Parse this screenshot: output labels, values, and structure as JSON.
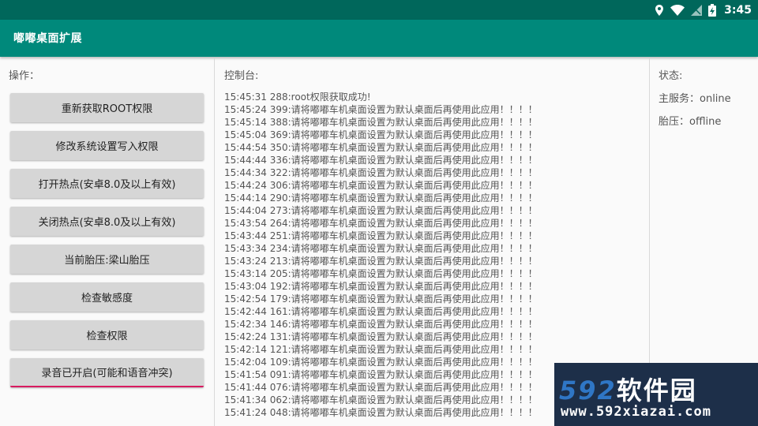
{
  "status_bar": {
    "time": "3:45",
    "icons": [
      "location-icon",
      "wifi-icon",
      "signal-icon",
      "battery-charging-icon"
    ]
  },
  "app_bar": {
    "title": "嘟嘟桌面扩展"
  },
  "operations": {
    "label": "操作：",
    "buttons": [
      "重新获取ROOT权限",
      "修改系统设置写入权限",
      "打开热点(安卓8.0及以上有效)",
      "关闭热点(安卓8.0及以上有效)",
      "当前胎压:梁山胎压",
      "检查敏感度",
      "检查权限",
      "录音已开启(可能和语音冲突)"
    ]
  },
  "console": {
    "label": "控制台:",
    "lines": [
      "15:45:31 288:root权限获取成功!",
      "15:45:24 399:请将嘟嘟车机桌面设置为默认桌面后再使用此应用！！！！",
      "15:45:14 388:请将嘟嘟车机桌面设置为默认桌面后再使用此应用！！！！",
      "15:45:04 369:请将嘟嘟车机桌面设置为默认桌面后再使用此应用！！！！",
      "15:44:54 350:请将嘟嘟车机桌面设置为默认桌面后再使用此应用！！！！",
      "15:44:44 336:请将嘟嘟车机桌面设置为默认桌面后再使用此应用！！！！",
      "15:44:34 322:请将嘟嘟车机桌面设置为默认桌面后再使用此应用！！！！",
      "15:44:24 306:请将嘟嘟车机桌面设置为默认桌面后再使用此应用！！！！",
      "15:44:14 290:请将嘟嘟车机桌面设置为默认桌面后再使用此应用！！！！",
      "15:44:04 273:请将嘟嘟车机桌面设置为默认桌面后再使用此应用！！！！",
      "15:43:54 264:请将嘟嘟车机桌面设置为默认桌面后再使用此应用！！！！",
      "15:43:44 251:请将嘟嘟车机桌面设置为默认桌面后再使用此应用！！！！",
      "15:43:34 234:请将嘟嘟车机桌面设置为默认桌面后再使用此应用！！！！",
      "15:43:24 213:请将嘟嘟车机桌面设置为默认桌面后再使用此应用！！！！",
      "15:43:14 205:请将嘟嘟车机桌面设置为默认桌面后再使用此应用！！！！",
      "15:43:04 192:请将嘟嘟车机桌面设置为默认桌面后再使用此应用！！！！",
      "15:42:54 179:请将嘟嘟车机桌面设置为默认桌面后再使用此应用！！！！",
      "15:42:44 161:请将嘟嘟车机桌面设置为默认桌面后再使用此应用！！！！",
      "15:42:34 146:请将嘟嘟车机桌面设置为默认桌面后再使用此应用！！！！",
      "15:42:24 131:请将嘟嘟车机桌面设置为默认桌面后再使用此应用！！！！",
      "15:42:14 121:请将嘟嘟车机桌面设置为默认桌面后再使用此应用！！！！",
      "15:42:04 109:请将嘟嘟车机桌面设置为默认桌面后再使用此应用！！！！",
      "15:41:54 091:请将嘟嘟车机桌面设置为默认桌面后再使用此应用！！！！",
      "15:41:44 076:请将嘟嘟车机桌面设置为默认桌面后再使用此应用！！！！",
      "15:41:34 062:请将嘟嘟车机桌面设置为默认桌面后再使用此应用！！！！",
      "15:41:24 048:请将嘟嘟车机桌面设置为默认桌面后再使用此应用！！！！"
    ]
  },
  "status": {
    "label": "状态:",
    "main_service": "主服务：online",
    "tire_pressure": "胎压：offline"
  },
  "watermark": {
    "digits": "592",
    "text": "软件园",
    "url": "www.592xiazai.com"
  },
  "colors": {
    "status_bar": "#00675b",
    "app_bar": "#00897b",
    "button": "#d6d6d6",
    "accent": "#d81b60"
  }
}
